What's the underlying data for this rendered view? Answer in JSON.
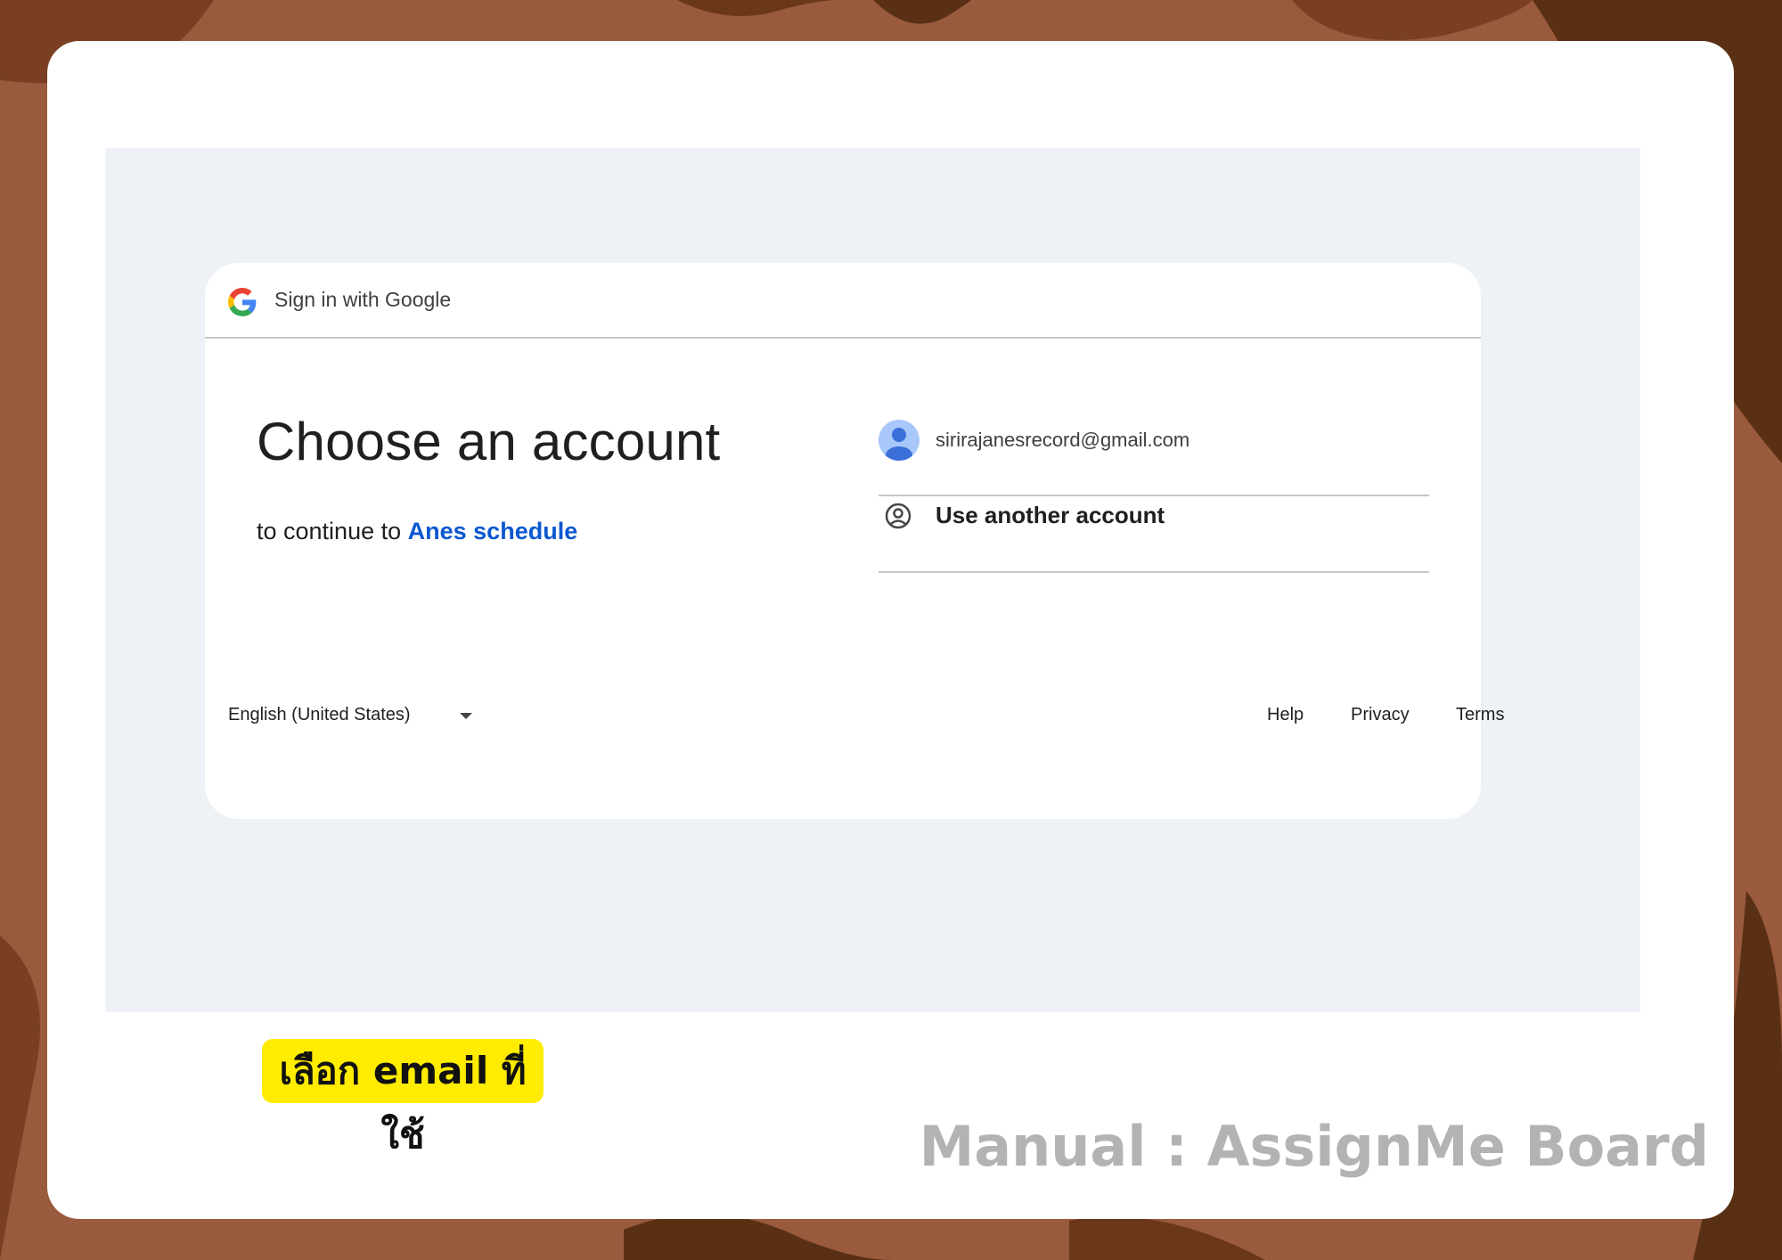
{
  "colors": {
    "background_brown": "#9a5a3d",
    "dark_brown": "#5a3014",
    "frame": "#ffffff",
    "screen_bg": "#eef2f7",
    "link_blue": "#0b57d0",
    "badge_yellow": "#ffec00",
    "watermark_gray": "#b3b3b3"
  },
  "header": {
    "icon": "google-logo",
    "title": "Sign in with Google"
  },
  "main": {
    "heading": "Choose an account",
    "subtitle_prefix": "to continue to",
    "app_name": "Anes schedule"
  },
  "accounts": {
    "existing": {
      "icon": "avatar-person-icon",
      "email": "sirirajanesrecord@gmail.com"
    },
    "other": {
      "icon": "account-circle-icon",
      "label": "Use another account"
    }
  },
  "footer": {
    "language": "English (United States)",
    "links": [
      "Help",
      "Privacy",
      "Terms"
    ]
  },
  "annotation": {
    "badge_text": "เลือก email ที่ใช้",
    "manual_title": "Manual : AssignMe Board"
  }
}
